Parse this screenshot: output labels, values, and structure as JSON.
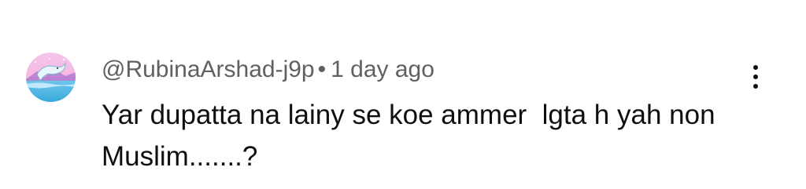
{
  "comment": {
    "author": "@RubinaArshad-j9p",
    "separator": "•",
    "timestamp": "1 day ago",
    "text_line1": "Yar dupatta na lainy se koe ammer  lgta h yah non",
    "text_line2": "Muslim.......?"
  },
  "icons": {
    "avatar": "dolphin-sunset-avatar",
    "menu": "more-vertical-icon"
  },
  "colors": {
    "author_text": "#606060",
    "body_text": "#0f0f0f",
    "background": "#ffffff"
  }
}
